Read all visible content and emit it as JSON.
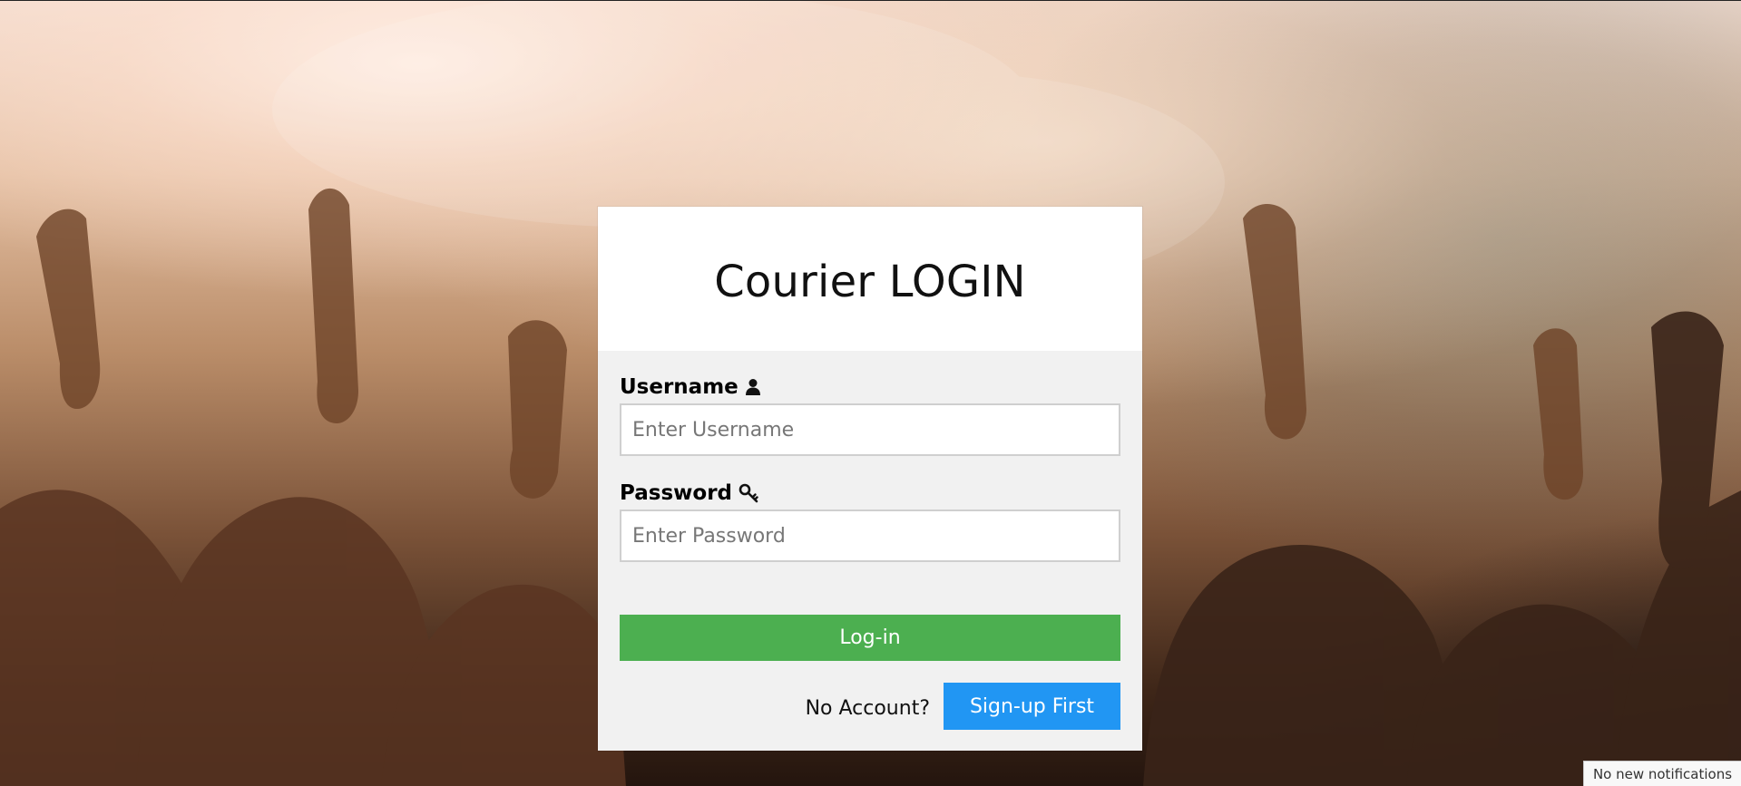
{
  "login": {
    "title": "Courier LOGIN",
    "username": {
      "label": "Username",
      "placeholder": "Enter Username",
      "value": "",
      "icon": "user-icon"
    },
    "password": {
      "label": "Password",
      "placeholder": "Enter Password",
      "value": "",
      "icon": "key-icon"
    },
    "login_button": "Log-in",
    "no_account_text": "No Account?",
    "signup_button": "Sign-up First"
  },
  "notification": {
    "text": "No new notifications"
  },
  "colors": {
    "login_button": "#4caf50",
    "signup_button": "#2196f3",
    "card_body": "#f1f1f1",
    "card_header": "#ffffff"
  }
}
